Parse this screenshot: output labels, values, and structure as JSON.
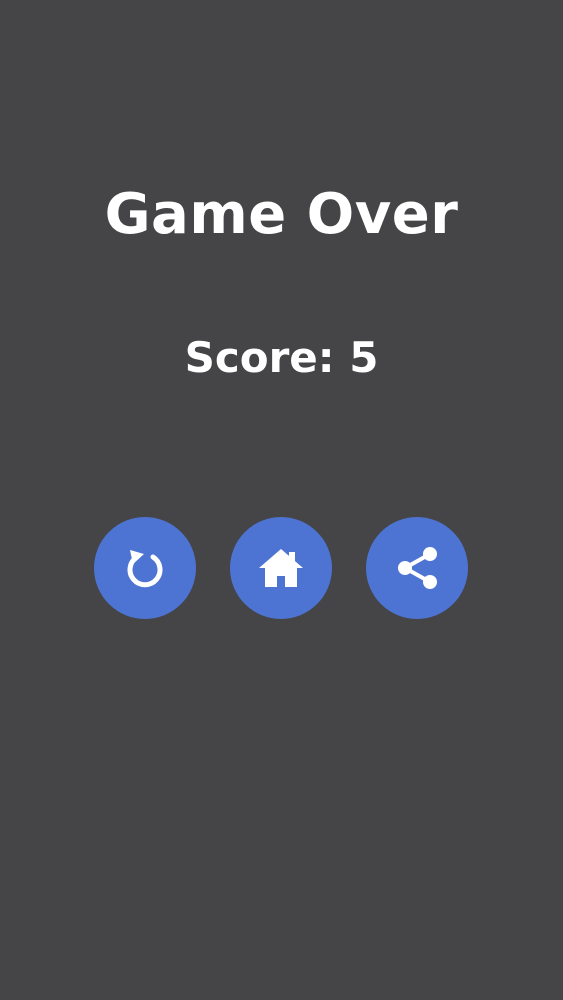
{
  "game_over": {
    "title": "Game Over",
    "score_label": "Score: 5"
  },
  "buttons": {
    "restart_icon": "restart-icon",
    "home_icon": "home-icon",
    "share_icon": "share-icon",
    "accent_color": "#4d74d3"
  },
  "theme": {
    "background": "#454446",
    "text_color": "#ffffff"
  }
}
